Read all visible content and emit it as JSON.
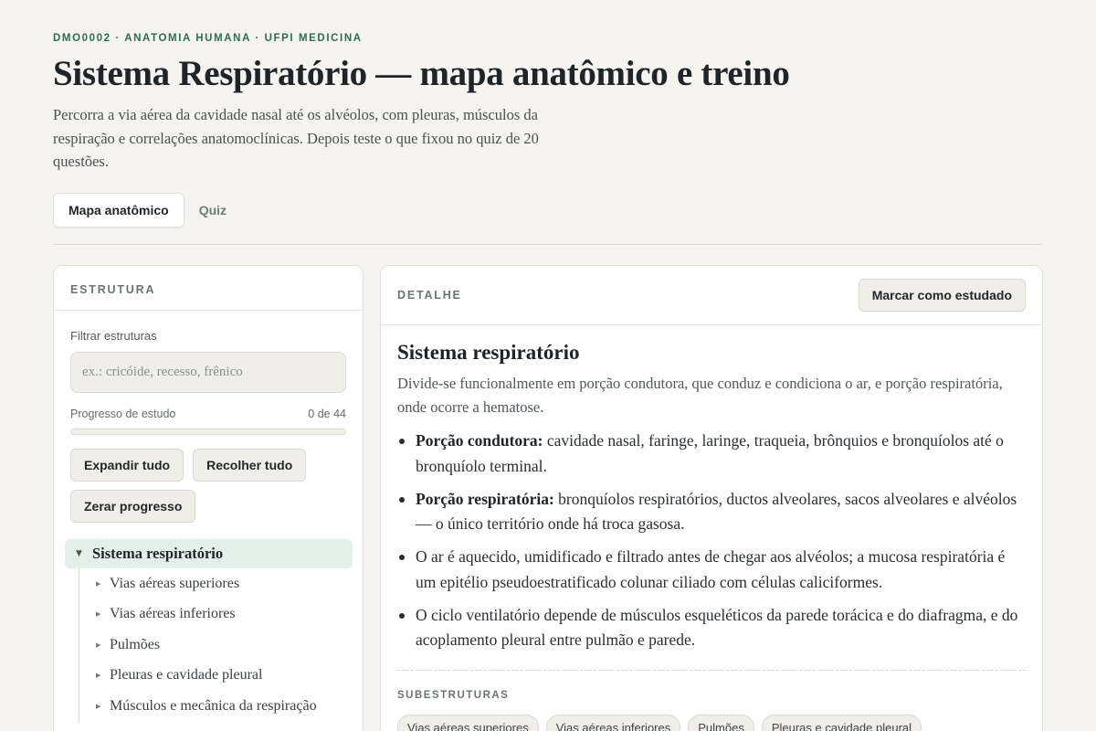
{
  "header": {
    "eyebrow": "DMO0002 · ANATOMIA HUMANA · UFPI MEDICINA",
    "title": "Sistema Respiratório — mapa anatômico e treino",
    "lead": "Percorra a via aérea da cavidade nasal até os alvéolos, com pleuras, músculos da respiração e correlações anatomoclínicas. Depois teste o que fixou no quiz de 20 questões."
  },
  "tabs": [
    {
      "label": "Mapa anatômico",
      "active": true
    },
    {
      "label": "Quiz",
      "active": false
    }
  ],
  "sidebar": {
    "heading": "ESTRUTURA",
    "filter_label": "Filtrar estruturas",
    "filter_placeholder": "ex.: cricóide, recesso, frênico",
    "progress_label": "Progresso de estudo",
    "progress_count": "0 de 44",
    "progress_fraction": 0,
    "buttons": {
      "expand": "Expandir tudo",
      "collapse": "Recolher tudo",
      "reset": "Zerar progresso"
    },
    "tree": {
      "root": "Sistema respiratório",
      "children": [
        "Vias aéreas superiores",
        "Vias aéreas inferiores",
        "Pulmões",
        "Pleuras e cavidade pleural",
        "Músculos e mecânica da respiração"
      ]
    }
  },
  "detail": {
    "heading": "DETALHE",
    "mark_button": "Marcar como estudado",
    "title": "Sistema respiratório",
    "intro": "Divide-se funcionalmente em porção condutora, que conduz e condiciona o ar, e porção respiratória, onde ocorre a hematose.",
    "bullets": [
      {
        "term": "Porção condutora:",
        "text": " cavidade nasal, faringe, laringe, traqueia, brônquios e bronquíolos até o bronquíolo terminal."
      },
      {
        "term": "Porção respiratória:",
        "text": " bronquíolos respiratórios, ductos alveolares, sacos alveolares e alvéolos — o único território onde há troca gasosa."
      },
      {
        "term": "",
        "text": "O ar é aquecido, umidificado e filtrado antes de chegar aos alvéolos; a mucosa respiratória é um epitélio pseudoestratificado colunar ciliado com células caliciformes."
      },
      {
        "term": "",
        "text": "O ciclo ventilatório depende de músculos esqueléticos da parede torácica e do diafragma, e do acoplamento pleural entre pulmão e parede."
      }
    ],
    "substructures_label": "SUBESTRUTURAS",
    "substructures": [
      "Vias aéreas superiores",
      "Vias aéreas inferiores",
      "Pulmões",
      "Pleuras e cavidade pleural"
    ]
  },
  "colors": {
    "accent": "#2f6b55",
    "background": "#f5f4f0",
    "selected_row": "#e3efe9"
  }
}
